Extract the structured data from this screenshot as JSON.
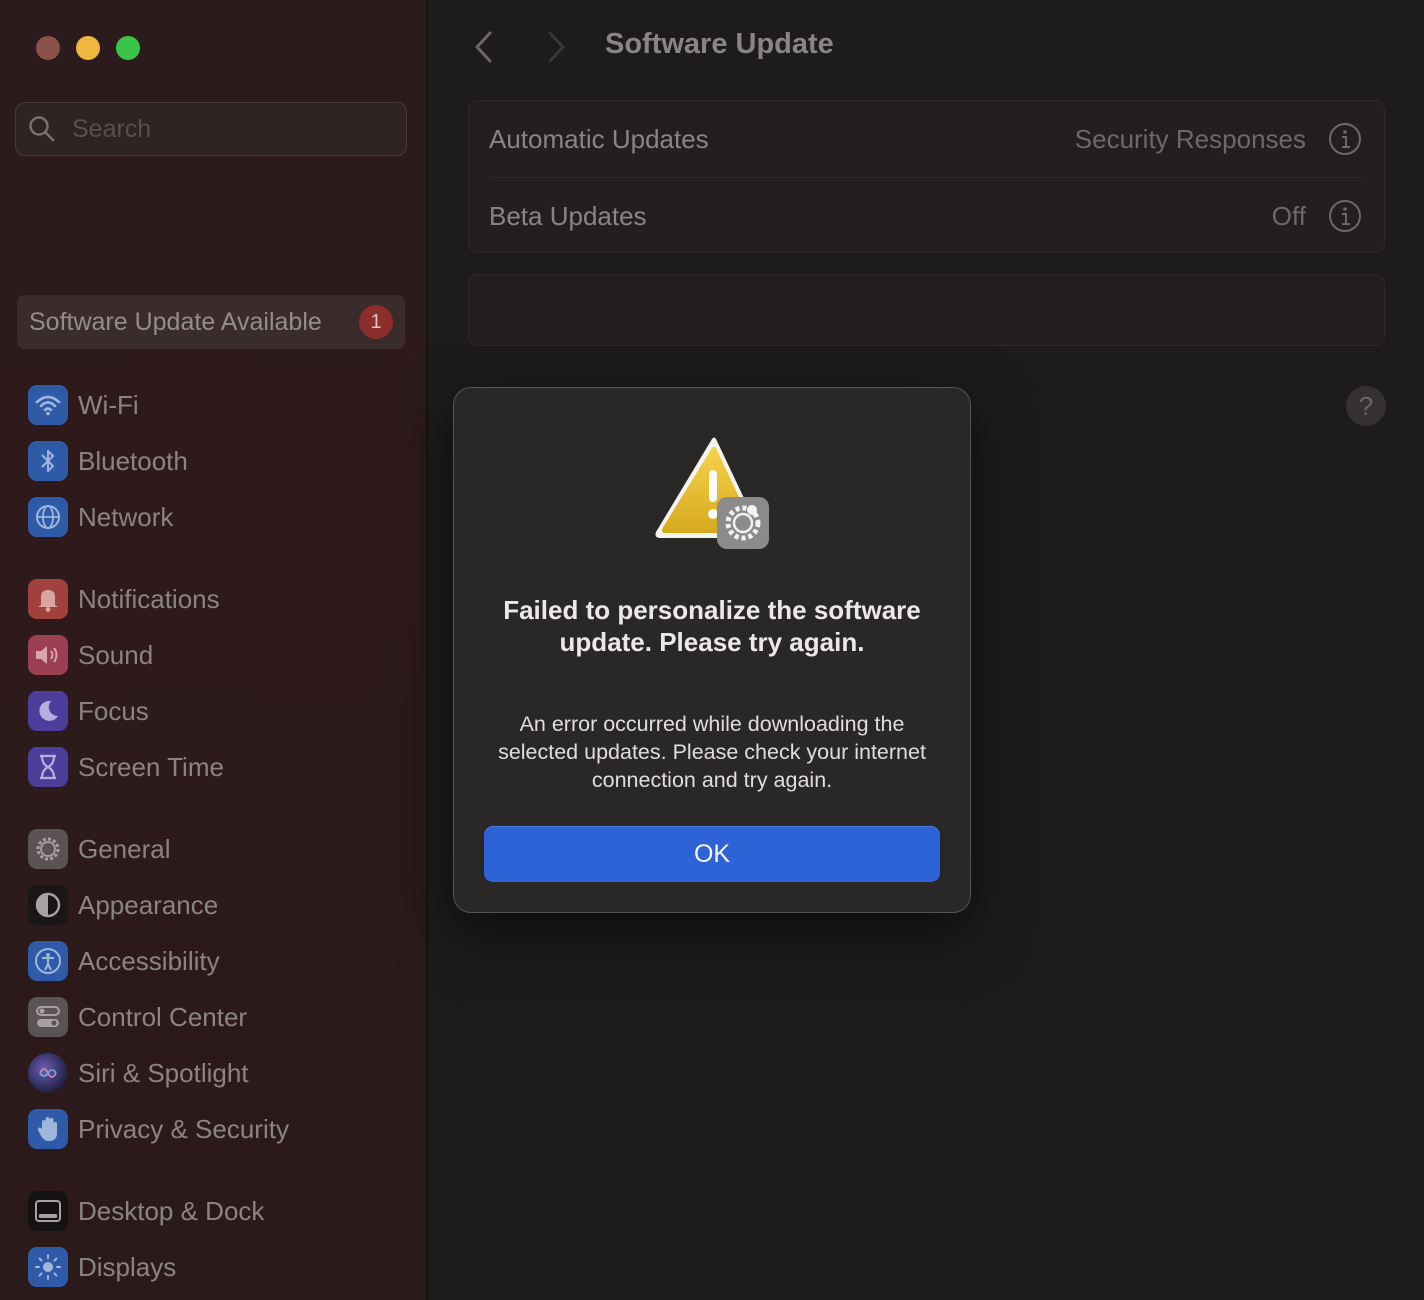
{
  "window": {
    "controls": [
      "close",
      "minimize",
      "zoom"
    ],
    "colors": {
      "close": "#8a5149",
      "minimize": "#f0b83e",
      "zoom": "#3bc44a"
    }
  },
  "sidebar": {
    "search_placeholder": "Search",
    "update_banner": {
      "label": "Software Update Available",
      "badge": "1"
    },
    "items": [
      {
        "label": "Wi-Fi",
        "icon": "wifi-icon"
      },
      {
        "label": "Bluetooth",
        "icon": "bluetooth-icon"
      },
      {
        "label": "Network",
        "icon": "globe-icon"
      },
      {
        "label": "Notifications",
        "icon": "bell-icon"
      },
      {
        "label": "Sound",
        "icon": "speaker-icon"
      },
      {
        "label": "Focus",
        "icon": "moon-icon"
      },
      {
        "label": "Screen Time",
        "icon": "hourglass-icon"
      },
      {
        "label": "General",
        "icon": "gear-icon"
      },
      {
        "label": "Appearance",
        "icon": "appearance-icon"
      },
      {
        "label": "Accessibility",
        "icon": "accessibility-icon"
      },
      {
        "label": "Control Center",
        "icon": "toggles-icon"
      },
      {
        "label": "Siri & Spotlight",
        "icon": "siri-icon"
      },
      {
        "label": "Privacy & Security",
        "icon": "hand-icon"
      },
      {
        "label": "Desktop & Dock",
        "icon": "dock-icon"
      },
      {
        "label": "Displays",
        "icon": "sun-icon"
      }
    ]
  },
  "header": {
    "title": "Software Update"
  },
  "settings": {
    "automatic_updates": {
      "label": "Automatic Updates",
      "value": "Security Responses"
    },
    "beta_updates": {
      "label": "Beta Updates",
      "value": "Off"
    }
  },
  "help_label": "?",
  "dialog": {
    "icon": "warning-gear-icon",
    "title": "Failed to personalize the software update. Please try again.",
    "message": "An error occurred while downloading the selected updates. Please check your internet connection and try again.",
    "ok_label": "OK"
  }
}
